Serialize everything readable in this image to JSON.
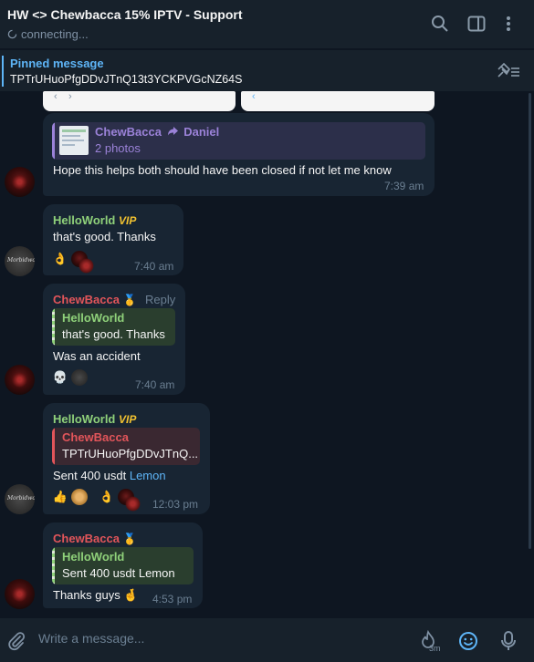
{
  "header": {
    "title": "HW <> Chewbacca 15% IPTV - Support",
    "status": "connecting..."
  },
  "pinned": {
    "label": "Pinned message",
    "text": "TPTrUHuoPfgDDvJTnQ13t3YCKPVGcNZ64S"
  },
  "messages": [
    {
      "forward_name": "ChewBacca",
      "forward_to": "Daniel",
      "forward_sub": "2 photos",
      "text": "Hope this helps both should have been closed if not let me know",
      "time": "7:39 am"
    },
    {
      "sender": "HelloWorld",
      "badge": "VIP",
      "text": "that's good. Thanks",
      "reaction_emoji": "👌",
      "time": "7:40 am"
    },
    {
      "sender": "ChewBacca",
      "badge": "🥇",
      "reply_label": "Reply",
      "quote_name": "HelloWorld",
      "quote_text": "that's good. Thanks",
      "text": "Was an accident",
      "reaction_emoji": "💀",
      "time": "7:40 am"
    },
    {
      "sender": "HelloWorld",
      "badge": "VIP",
      "quote_name": "ChewBacca",
      "quote_text": "TPTrUHuoPfgDDvJTnQ...",
      "text": "Sent 400 usdt ",
      "text_link": "Lemon",
      "reaction_emoji_1": "👍",
      "reaction_emoji_2": "👌",
      "time": "12:03 pm"
    },
    {
      "sender": "ChewBacca",
      "badge": "🥇",
      "quote_name": "HelloWorld",
      "quote_text": "Sent 400 usdt Lemon",
      "text": "Thanks guys 🤞",
      "time": "4:53 pm"
    }
  ],
  "composer": {
    "placeholder": "Write a message...",
    "timer_label": "3m"
  },
  "colors": {
    "background": "#0e1621",
    "bubble": "#182533",
    "header": "#17212b",
    "accent": "#5eb5f7",
    "helloworld_name": "#8fd17a",
    "chewbacca_name": "#e2555a"
  },
  "icons": [
    "search-icon",
    "sidebar-toggle-icon",
    "more-vertical-icon",
    "unpin-icon",
    "attach-icon",
    "timer-icon",
    "emoji-icon",
    "microphone-icon"
  ]
}
